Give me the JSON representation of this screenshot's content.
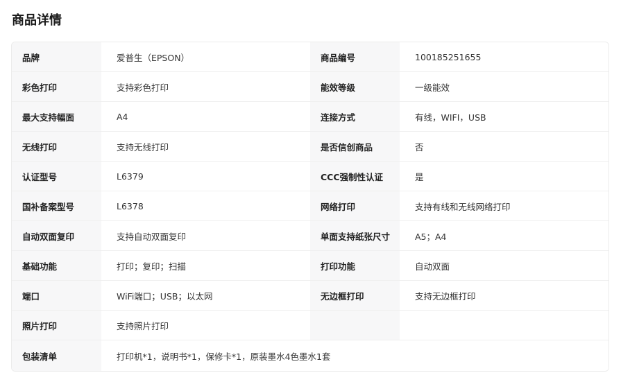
{
  "section": {
    "title": "商品详情"
  },
  "specs": [
    {
      "l1": "品牌",
      "v1": "爱普生（EPSON）",
      "l2": "商品编号",
      "v2": "100185251655"
    },
    {
      "l1": "彩色打印",
      "v1": "支持彩色打印",
      "l2": "能效等级",
      "v2": "一级能效"
    },
    {
      "l1": "最大支持幅面",
      "v1": "A4",
      "l2": "连接方式",
      "v2": "有线，WIFI，USB"
    },
    {
      "l1": "无线打印",
      "v1": "支持无线打印",
      "l2": "是否信创商品",
      "v2": "否"
    },
    {
      "l1": "认证型号",
      "v1": "L6379",
      "l2": "CCC强制性认证",
      "v2": "是"
    },
    {
      "l1": "国补备案型号",
      "v1": "L6378",
      "l2": "网络打印",
      "v2": "支持有线和无线网络打印"
    },
    {
      "l1": "自动双面复印",
      "v1": "支持自动双面复印",
      "l2": "单面支持纸张尺寸",
      "v2": "A5；A4"
    },
    {
      "l1": "基础功能",
      "v1": "打印；复印；扫描",
      "l2": "打印功能",
      "v2": "自动双面"
    },
    {
      "l1": "端口",
      "v1": "WiFi端口；USB；以太网",
      "l2": "无边框打印",
      "v2": "支持无边框打印"
    },
    {
      "l1": "照片打印",
      "v1": "支持照片打印",
      "l2": "",
      "v2": ""
    }
  ],
  "package": {
    "label": "包装清单",
    "value": "打印机*1，说明书*1，保修卡*1，原装墨水4色墨水1套"
  }
}
